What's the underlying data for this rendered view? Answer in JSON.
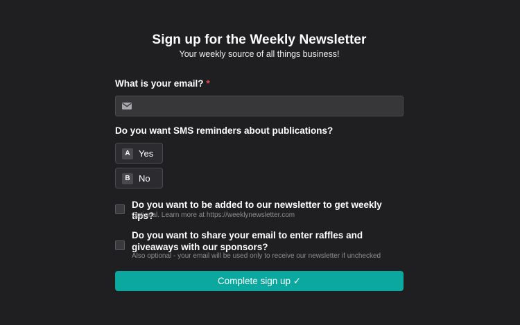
{
  "header": {
    "title": "Sign up for the Weekly Newsletter",
    "subtitle": "Your weekly source of all things business!"
  },
  "email": {
    "label": "What is your email?",
    "required_marker": "*",
    "value": "",
    "placeholder": "",
    "icon": "envelope-icon"
  },
  "sms": {
    "question": "Do you want SMS reminders about publications?",
    "options": [
      {
        "key": "A",
        "label": "Yes"
      },
      {
        "key": "B",
        "label": "No"
      }
    ]
  },
  "checkboxes": [
    {
      "label": "Do you want to be added to our newsletter to get weekly tips?",
      "help": "Optional. Learn more at https://weeklynewsletter.com",
      "checked": false
    },
    {
      "label": "Do you want to share your email to enter raffles and giveaways with our sponsors?",
      "help": "Also optional - your email will be used only to receive our newsletter if unchecked",
      "checked": false
    }
  ],
  "submit": {
    "label": "Complete sign up ✓"
  },
  "colors": {
    "background": "#1f1f22",
    "accent": "#0aa89f",
    "required": "#e5484d"
  }
}
